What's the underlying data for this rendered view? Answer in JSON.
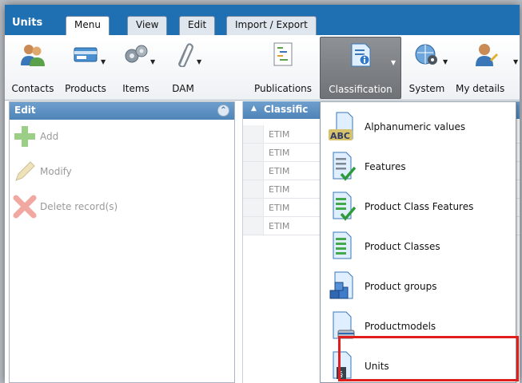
{
  "app": {
    "title": "Units"
  },
  "tabs": [
    {
      "label": "Menu",
      "active": true
    },
    {
      "label": "View",
      "active": false
    },
    {
      "label": "Edit",
      "active": false
    },
    {
      "label": "Import / Export",
      "active": false
    }
  ],
  "ribbon": [
    {
      "label": "Contacts",
      "icon": "contacts-icon",
      "dropdown": false
    },
    {
      "label": "Products",
      "icon": "products-icon",
      "dropdown": true
    },
    {
      "label": "Items",
      "icon": "items-icon",
      "dropdown": true
    },
    {
      "label": "DAM",
      "icon": "paperclip-icon",
      "dropdown": true
    },
    {
      "label": "Publications",
      "icon": "publications-icon",
      "dropdown": false
    },
    {
      "label": "Classification",
      "icon": "classification-icon",
      "dropdown": true,
      "active": true
    },
    {
      "label": "System",
      "icon": "system-icon",
      "dropdown": true
    },
    {
      "label": "My details",
      "icon": "my-details-icon",
      "dropdown": true
    }
  ],
  "edit_panel": {
    "title": "Edit",
    "actions": [
      {
        "label": "Add",
        "icon": "add-icon"
      },
      {
        "label": "Modify",
        "icon": "pencil-icon"
      },
      {
        "label": "Delete record(s)",
        "icon": "delete-icon"
      }
    ]
  },
  "grid": {
    "column_header": "Classific",
    "rows": [
      "ETIM",
      "ETIM",
      "ETIM",
      "ETIM",
      "ETIM",
      "ETIM"
    ]
  },
  "menu": {
    "items": [
      {
        "label": "Alphanumeric values",
        "icon": "alphanumeric-icon"
      },
      {
        "label": "Features",
        "icon": "features-icon"
      },
      {
        "label": "Product Class Features",
        "icon": "product-class-features-icon"
      },
      {
        "label": "Product Classes",
        "icon": "product-classes-icon"
      },
      {
        "label": "Product groups",
        "icon": "product-groups-icon"
      },
      {
        "label": "Productmodels",
        "icon": "productmodels-icon"
      },
      {
        "label": "Units",
        "icon": "units-icon",
        "highlighted": true
      }
    ]
  },
  "colors": {
    "accent": "#1f6fb3",
    "panel_header": "#4f84b8",
    "highlight": "#e11e1e"
  }
}
